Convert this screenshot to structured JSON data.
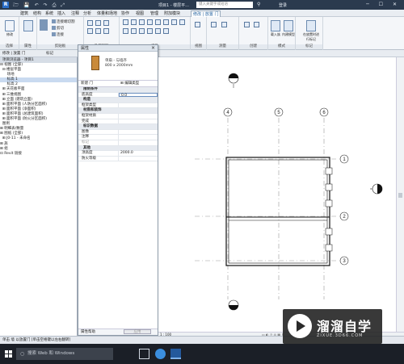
{
  "titlebar": {
    "app_logo": "R",
    "qat": "🗁 💾 ↶ ↷ ⎙ ⤢",
    "title": "项目1 - 楼层平...",
    "search_placeholder": "键入关键字或短语",
    "login": "登录",
    "window_controls": "─ ☐ ✕"
  },
  "menu_tabs": [
    "建筑",
    "结构",
    "系统",
    "插入",
    "注释",
    "分析",
    "体量和场地",
    "协作",
    "视图",
    "管理",
    "附加模块",
    "修改 | 放置 门"
  ],
  "ribbon": {
    "modify_label": "修改",
    "select_group": "选择",
    "props_group": "属性",
    "clipboard_items": [
      "连接端切割",
      "剪切",
      "连接"
    ],
    "clipboard_group": "剪贴板",
    "geometry_group": "几何图形",
    "modify_group": "修改",
    "view_group": "视图",
    "measure_group": "测量",
    "create_group": "创建",
    "mode_group": "模式",
    "tag_group": "标记",
    "load_family": "载入族",
    "inplace_model": "内建模型",
    "tag_on_place": "在放置时进行标记"
  },
  "options_bar": {
    "left": "修改 | 放置 门",
    "mid": "标记"
  },
  "browser": {
    "title": "项目浏览器 - 项目1",
    "items": [
      "⊟ 视图 (全部)",
      "  ⊟ 楼层平面",
      "      场地",
      "      标高 1",
      "      标高 2",
      "  ⊞ 天花板平面",
      "  ⊞ 三维视图",
      "  ⊞ 立面 (建筑立面)",
      "  ⊞ 面积平面 (人防分区面积)",
      "  ⊞ 面积平面 (净面积)",
      "  ⊞ 面积平面 (总建筑面积)",
      "  ⊞ 面积平面 (防火分区面积)",
      "  图例",
      "⊞ 明细表/数量",
      "⊞ 图纸 (全部)",
      "  ⊞ J0-11 - 未命名",
      "⊞ 族",
      "⊞ 组",
      "⊡ Revit 链接"
    ],
    "selected_index": 3
  },
  "properties": {
    "title": "属性",
    "type_name_1": "单扇 - 与墙齐",
    "type_name_2": "800 x 2000mm",
    "instance_selector": "新建 门",
    "edit_type": "编辑类型",
    "rows": [
      {
        "k": "限制条件",
        "v": "",
        "cat": true
      },
      {
        "k": "底高度",
        "v": "0.0",
        "input": true
      },
      {
        "k": "构造",
        "v": "",
        "cat": true
      },
      {
        "k": "框架类型",
        "v": ""
      },
      {
        "k": "材质和装饰",
        "v": "",
        "cat": true
      },
      {
        "k": "框架材质",
        "v": ""
      },
      {
        "k": "完成",
        "v": ""
      },
      {
        "k": "标识数据",
        "v": "",
        "cat": true
      },
      {
        "k": "图像",
        "v": ""
      },
      {
        "k": "注释",
        "v": ""
      },
      {
        "k": "标记",
        "v": "",
        "disabled": true
      },
      {
        "k": "其他",
        "v": "",
        "cat": true
      },
      {
        "k": "顶高度",
        "v": "2000.0"
      },
      {
        "k": "防火等级",
        "v": ""
      }
    ],
    "help": "属性帮助",
    "apply": "应用"
  },
  "canvas": {
    "grid_top": [
      "4",
      "5",
      "6"
    ],
    "grid_right": [
      "1",
      "2",
      "3"
    ]
  },
  "viewbar": {
    "scale": "1 : 100"
  },
  "status": "单击 墙 以放置门 [单击空格键以左右翻转]",
  "taskbar": {
    "search": "搜索 Web 和 Windows"
  },
  "watermark": {
    "brand": "溜溜自学",
    "site": "ZIXUE.3D66.COM"
  }
}
